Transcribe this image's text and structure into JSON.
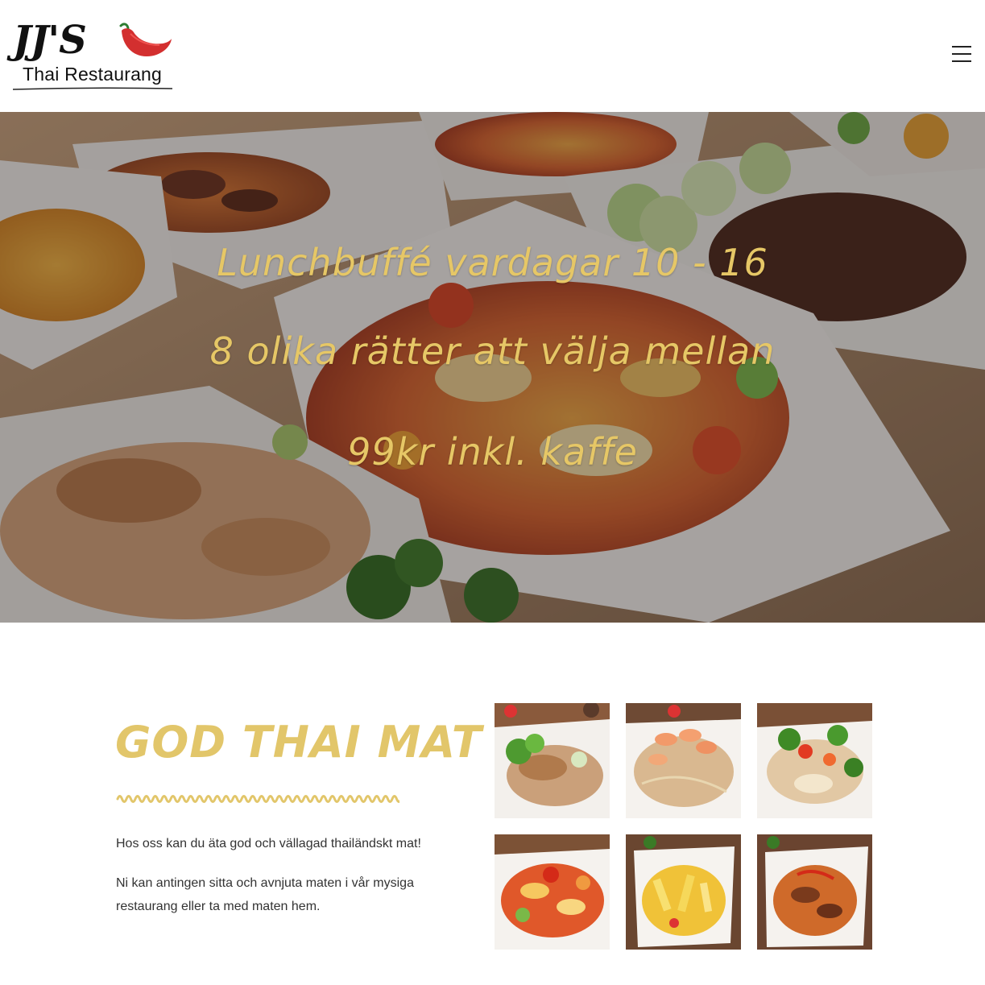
{
  "header": {
    "logo_mark": "JJ'S",
    "logo_sub": "Thai Restaurang",
    "menu_icon": "hamburger-menu-icon"
  },
  "hero": {
    "lines": [
      "Lunchbuffé vardagar 10 - 16",
      "8 olika rätter att välja mellan",
      "99kr inkl. kaffe"
    ],
    "text_color": "#e6c766"
  },
  "content": {
    "title": "GOD THAI MAT",
    "paragraph_1": "Hos oss kan du äta god och vällagad thailändskt mat!",
    "paragraph_2": "Ni kan antingen sitta och avnjuta maten i vår mysiga restaurang eller ta med maten hem.",
    "accent_color": "#e2c66a"
  },
  "gallery": {
    "tiles": [
      {
        "name": "chicken-stir-fry-dish"
      },
      {
        "name": "shrimp-noodles-dish"
      },
      {
        "name": "chicken-vegetable-dish"
      },
      {
        "name": "sweet-sour-dish"
      },
      {
        "name": "yellow-curry-dish"
      },
      {
        "name": "red-curry-dish"
      }
    ]
  }
}
